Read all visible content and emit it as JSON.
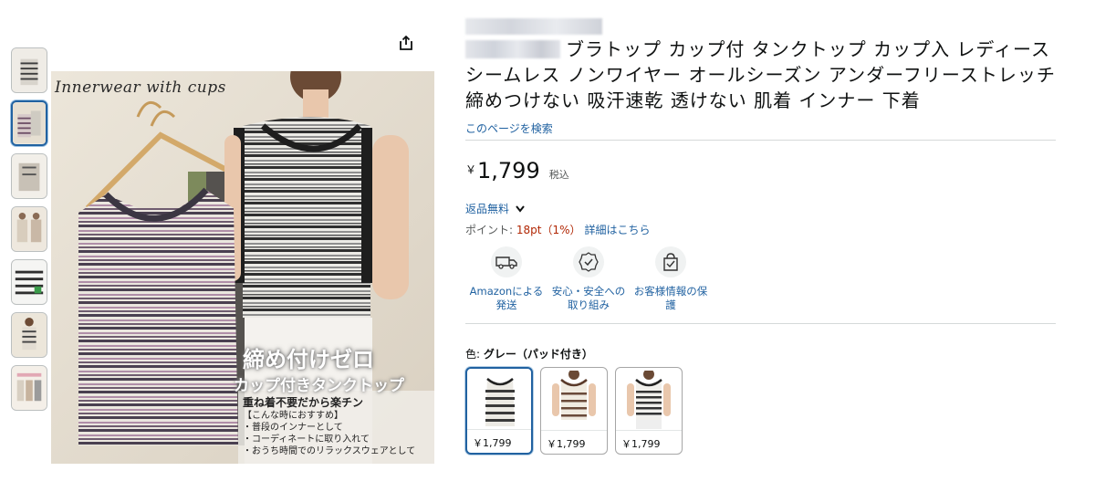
{
  "product": {
    "title_rest": "ブラトップ カップ付 タンクトップ カップ入 レディース シームレス ノンワイヤー オールシーズン アンダーフリーストレッチ 締めつけない 吸汗速乾 透けない 肌着 インナー 下着",
    "store_link": "このページを検索",
    "price_symbol": "￥",
    "price_value": "1,799",
    "price_tax": "税込",
    "returns": "返品無料",
    "points_label": "ポイント: ",
    "points_amount": "18pt（1%）",
    "points_link": "詳細はこちら"
  },
  "features": [
    {
      "icon": "delivery-van-icon",
      "label": "Amazonによる発送"
    },
    {
      "icon": "secure-badge-icon",
      "label": "安心・安全への取り組み"
    },
    {
      "icon": "protected-bag-icon",
      "label": "お客様情報の保護"
    }
  ],
  "variation": {
    "label": "色: ",
    "selected": "グレー（パッド付き）",
    "swatches": [
      {
        "price": "￥1,799"
      },
      {
        "price": "￥1,799"
      },
      {
        "price": "￥1,799"
      }
    ]
  },
  "main_image": {
    "script_text": "Innerwear with cups",
    "headline": "締め付けゼロ",
    "sub_headline": "カップ付きタンクトップ",
    "lead": "重ね着不要だから楽チン",
    "bullets": [
      "【こんな時におすすめ】",
      "・普段のインナーとして",
      "・コーディネートに取り入れて",
      "・おうち時間でのリラックスウェアとして"
    ]
  },
  "colors": {
    "link": "#2162a1",
    "price_points": "#b12704",
    "selected_border": "#2162a1"
  }
}
